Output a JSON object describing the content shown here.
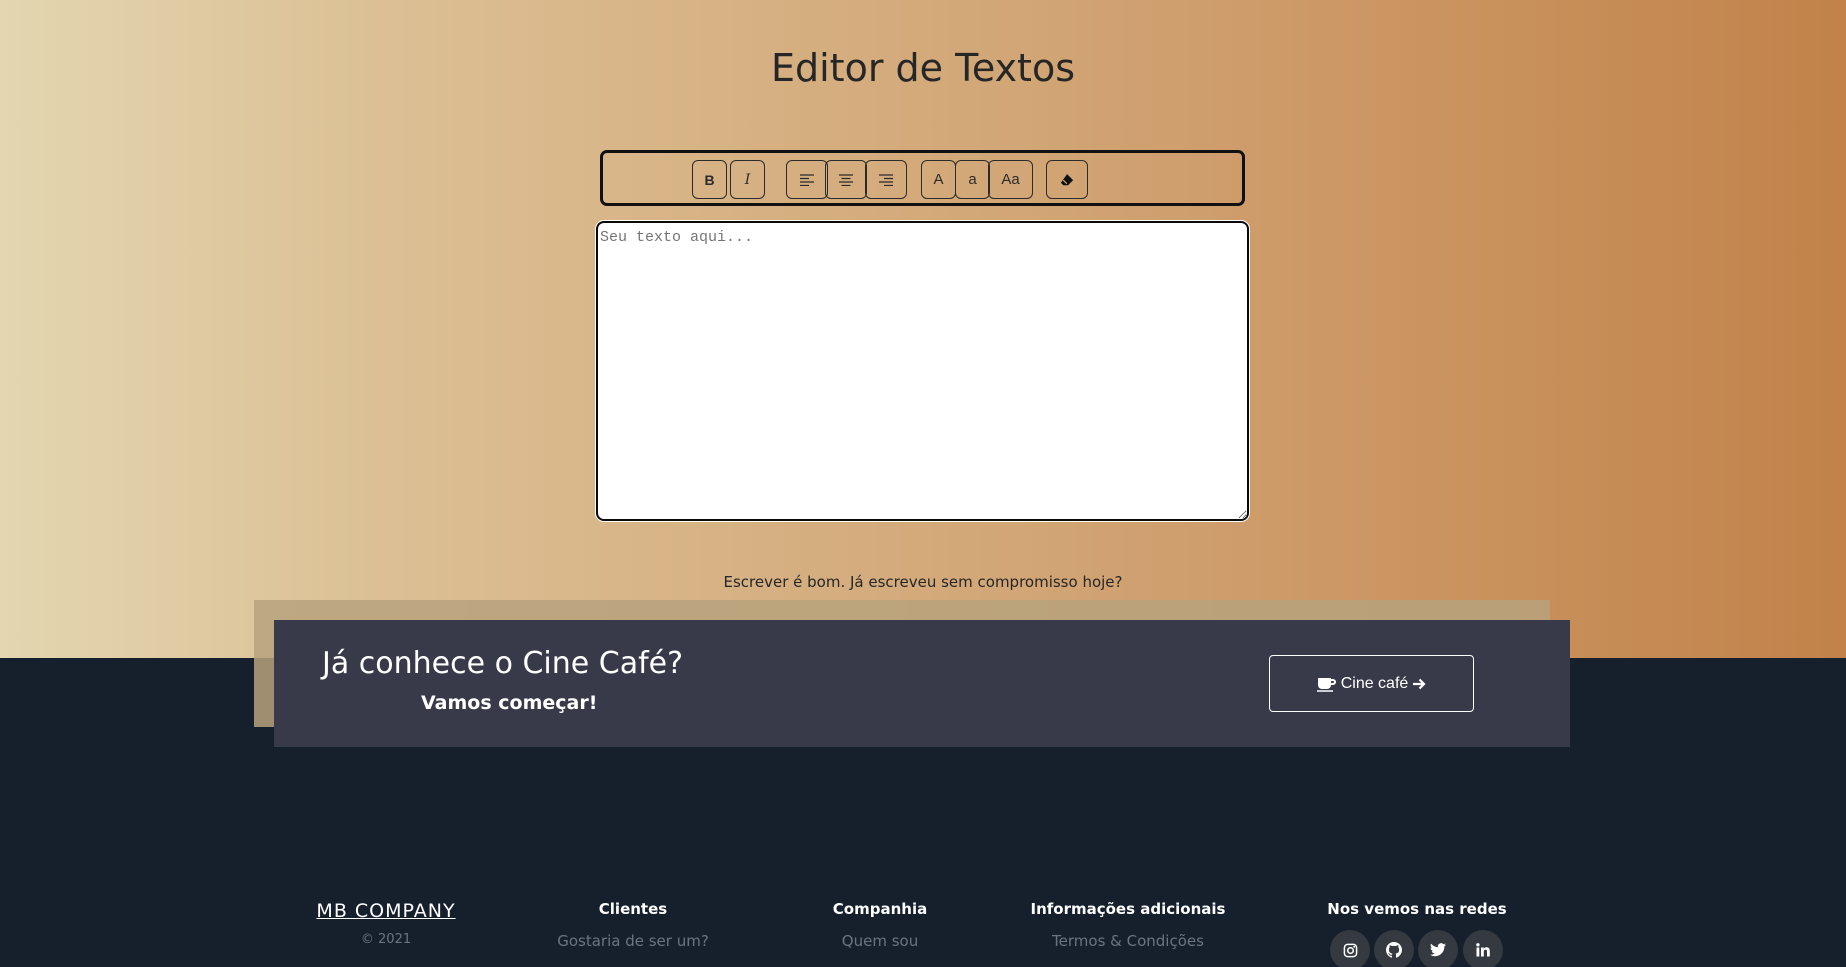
{
  "page": {
    "title": "Editor de Textos",
    "tagline": "Escrever é bom. Já escreveu sem compromisso hoje?"
  },
  "toolbar": {
    "bold": "B",
    "italic": "I",
    "uppercase": "A",
    "lowercase": "a",
    "capitalize": "Aa"
  },
  "editor": {
    "placeholder": "Seu texto aqui...",
    "value": ""
  },
  "promo": {
    "title": "Já conhece o Cine Café?",
    "subtitle": "Vamos começar!",
    "button_label": "Cine café"
  },
  "footer": {
    "brand": "MB COMPANY",
    "copyright": "© 2021",
    "columns": [
      {
        "heading": "Clientes",
        "link": "Gostaria de ser um?"
      },
      {
        "heading": "Companhia",
        "link": "Quem sou"
      },
      {
        "heading": "Informações adicionais",
        "link": "Termos & Condições"
      }
    ],
    "social_heading": "Nos vemos nas redes",
    "social_icons": [
      "instagram-icon",
      "github-icon",
      "twitter-icon",
      "linkedin-icon"
    ]
  },
  "colors": {
    "gradient_start": "#e3d6b0",
    "gradient_end": "#c2824a",
    "footer_bg": "#161f2c",
    "promo_bg": "#393a49"
  }
}
